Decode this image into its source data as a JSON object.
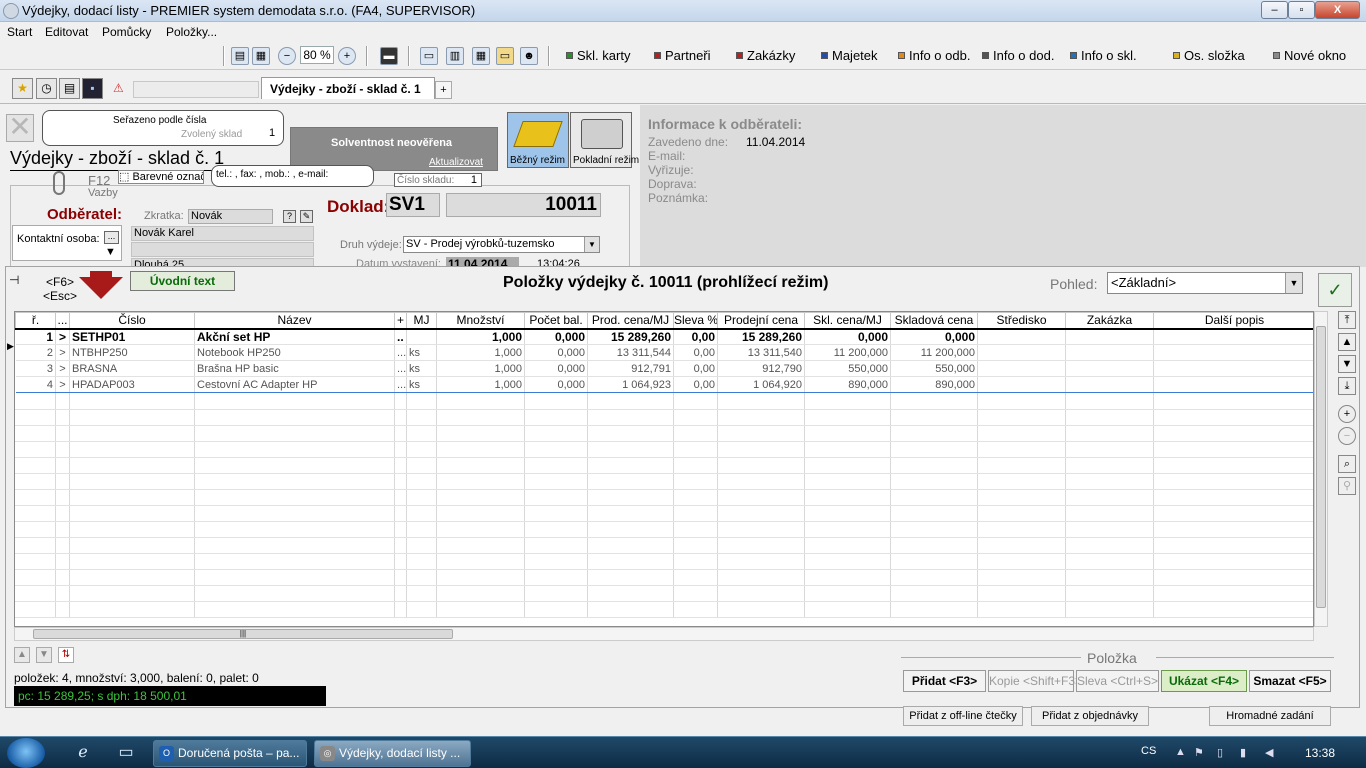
{
  "window": {
    "title": "Výdejky, dodací listy - PREMIER system demodata s.r.o. (FA4, SUPERVISOR)",
    "buttons": [
      "–",
      "▫",
      "X"
    ]
  },
  "menu": [
    "Start",
    "Editovat",
    "Pomůcky",
    "Položky..."
  ],
  "toolbar": {
    "zoom": "80 %",
    "links": [
      {
        "label": "Skl. karty",
        "color": "#2e8b2e"
      },
      {
        "label": "Partneři",
        "color": "#b22222"
      },
      {
        "label": "Zakázky",
        "color": "#b22222"
      },
      {
        "label": "Majetek",
        "color": "#2a4aa8"
      },
      {
        "label": "Info o odb.",
        "color": "#e08a1e"
      },
      {
        "label": "Info o dod.",
        "color": "#555555"
      },
      {
        "label": "Info o skl.",
        "color": "#2a70b8"
      },
      {
        "label": "Os. složka",
        "color": "#d8b020"
      },
      {
        "label": "Nové okno",
        "color": "#8a8a8a"
      }
    ]
  },
  "tabs": {
    "active": "Výdejky - zboží - sklad č. 1",
    "add": "+"
  },
  "header": {
    "sort_callout": {
      "line1": "Seřazeno podle čísla",
      "line2": "Zvolený sklad",
      "count": "1"
    },
    "solvency": {
      "status": "Solventnost neověřena",
      "update": "Aktualizovat"
    },
    "mode_normal": "Běžný režim",
    "mode_cash": "Pokladní režim",
    "page_title": "Výdejky - zboží - sklad č. 1",
    "f12": "F12",
    "links": "Vazby",
    "color_flag": "Barevné označení",
    "tel_callout": "tel.: , fax: , mob.: , e-mail:",
    "store": {
      "label": "Číslo skladu:",
      "value": "1"
    },
    "customer_label": "Odběratel:",
    "shortcut_label": "Zkratka:",
    "shortcut_value": "Novák",
    "contact_label": "Kontaktní osoba:",
    "contact_btn": "...",
    "customer_name": "Novák Karel",
    "customer_line2": "",
    "customer_street": "Dlouhá 25",
    "doc_label": "Doklad:",
    "doc_series": "SV1",
    "doc_number": "10011",
    "issue_type_label": "Druh výdeje:",
    "issue_type_value": "SV  - Prodej výrobků-tuzemsko",
    "date_label": "Datum vystavení:",
    "date_value": "11.04.2014",
    "time_value": "13:04:26"
  },
  "customer_info": {
    "heading": "Informace k odběrateli:",
    "registered_label": "Zavedeno dne:",
    "registered_value": "11.04.2014",
    "email_label": "E-mail:",
    "handles_label": "Vyřizuje:",
    "transport_label": "Doprava:",
    "note_label": "Poznámka:"
  },
  "items": {
    "nav_hint": "<F6>\n<Esc>",
    "nav_f6": "<F6>",
    "nav_esc": "<Esc>",
    "intro_button": "Úvodní text",
    "title": "Položky výdejky č. 10011 (prohlížecí režim)",
    "view_label": "Pohled:",
    "view_value": "<Základní>",
    "columns": [
      "ř.",
      "...",
      "Číslo",
      "Název",
      "+",
      "MJ",
      "Množství",
      "Počet bal.",
      "Prod. cena/MJ",
      "Sleva %",
      "Prodejní cena",
      "Skl. cena/MJ",
      "Skladová cena",
      "Středisko",
      "Zakázka",
      "Další popis"
    ],
    "rows": [
      {
        "n": "1",
        "mark": ">",
        "code": "SETHP01",
        "name": "Akční set HP",
        "plus": "..",
        "unit": "",
        "qty": "1,000",
        "packs": "0,000",
        "unit_price": "15 289,260",
        "discount": "0,00",
        "price": "15 289,260",
        "stock_unit": "0,000",
        "stock_price": "0,000",
        "center": "",
        "order": "",
        "desc": ""
      },
      {
        "n": "2",
        "mark": ">",
        "code": "NTBHP250",
        "name": "Notebook HP250",
        "plus": "...",
        "unit": "ks",
        "qty": "1,000",
        "packs": "0,000",
        "unit_price": "13 311,544",
        "discount": "0,00",
        "price": "13 311,540",
        "stock_unit": "11 200,000",
        "stock_price": "11 200,000",
        "center": "",
        "order": "",
        "desc": ""
      },
      {
        "n": "3",
        "mark": ">",
        "code": "BRASNA",
        "name": "Brašna HP basic",
        "plus": "...",
        "unit": "ks",
        "qty": "1,000",
        "packs": "0,000",
        "unit_price": "912,791",
        "discount": "0,00",
        "price": "912,790",
        "stock_unit": "550,000",
        "stock_price": "550,000",
        "center": "",
        "order": "",
        "desc": ""
      },
      {
        "n": "4",
        "mark": ">",
        "code": "HPADAP003",
        "name": "Cestovní  AC Adapter HP",
        "plus": "...",
        "unit": "ks",
        "qty": "1,000",
        "packs": "0,000",
        "unit_price": "1 064,923",
        "discount": "0,00",
        "price": "1 064,920",
        "stock_unit": "890,000",
        "stock_price": "890,000",
        "center": "",
        "order": "",
        "desc": ""
      }
    ],
    "summary": "položek: 4, množství: 3,000, balení: 0, palet: 0",
    "price_bar": "pc: 15 289,25; s dph: 18 500,01"
  },
  "item_actions": {
    "heading": "Položka",
    "add": "Přidat <F3>",
    "copy": "Kopie <Shift+F3>",
    "discount": "Sleva <Ctrl+S>",
    "show": "Ukázat <F4>",
    "delete": "Smazat <F5>",
    "add_offline": "Přidat z off-line čtečky",
    "add_order": "Přidat z objednávky",
    "bulk": "Hromadné zadání"
  },
  "taskbar": {
    "tasks": [
      "Doručená pošta – pa...",
      "Výdejky, dodací listy ..."
    ],
    "lang": "CS",
    "clock": "13:38"
  }
}
